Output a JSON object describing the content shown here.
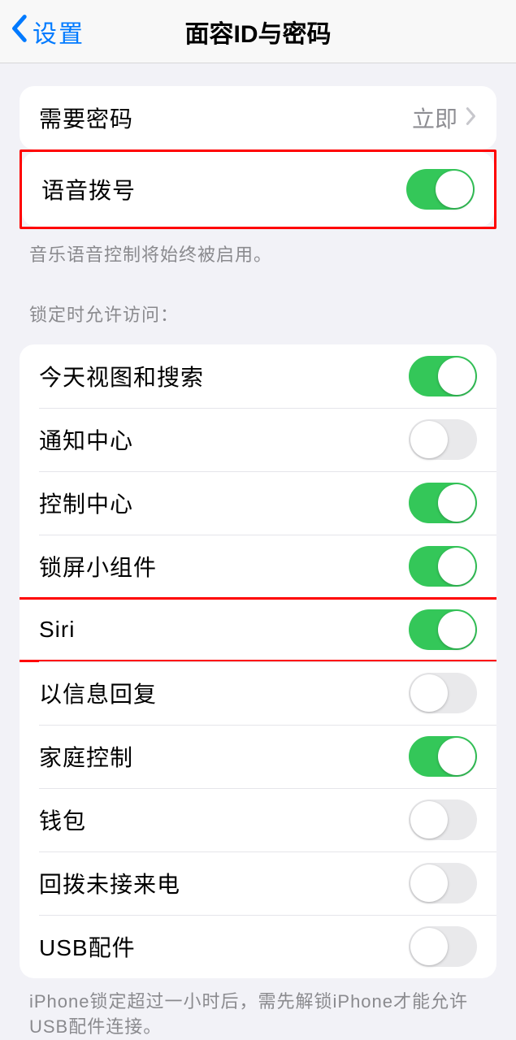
{
  "nav": {
    "back": "设置",
    "title": "面容ID与密码"
  },
  "requirePasscode": {
    "label": "需要密码",
    "value": "立即"
  },
  "voiceDial": {
    "label": "语音拨号",
    "on": true,
    "note": "音乐语音控制将始终被启用。"
  },
  "lockedAccess": {
    "header": "锁定时允许访问：",
    "items": [
      {
        "label": "今天视图和搜索",
        "on": true,
        "highlight": false
      },
      {
        "label": "通知中心",
        "on": false,
        "highlight": false
      },
      {
        "label": "控制中心",
        "on": true,
        "highlight": false
      },
      {
        "label": "锁屏小组件",
        "on": true,
        "highlight": false
      },
      {
        "label": "Siri",
        "on": true,
        "highlight": true
      },
      {
        "label": "以信息回复",
        "on": false,
        "highlight": false
      },
      {
        "label": "家庭控制",
        "on": true,
        "highlight": false
      },
      {
        "label": "钱包",
        "on": false,
        "highlight": false
      },
      {
        "label": "回拨未接来电",
        "on": false,
        "highlight": false
      },
      {
        "label": "USB配件",
        "on": false,
        "highlight": false
      }
    ],
    "footer": "iPhone锁定超过一小时后，需先解锁iPhone才能允许USB配件连接。"
  }
}
